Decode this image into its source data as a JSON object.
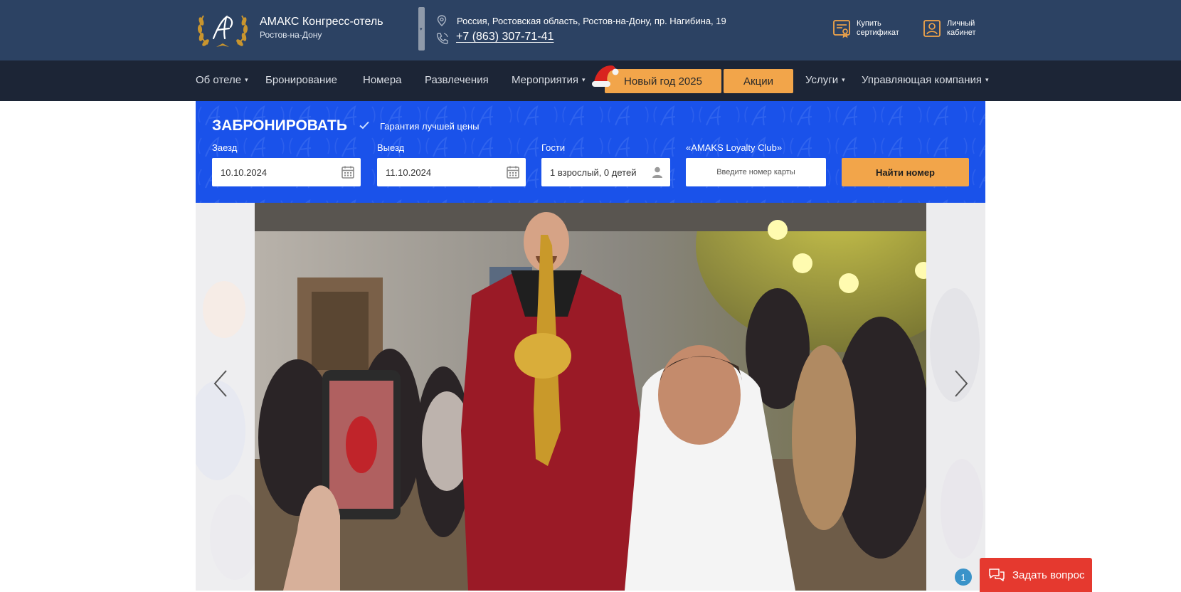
{
  "header": {
    "hotel_name": "АМАКС Конгресс-отель",
    "hotel_city": "Ростов-на-Дону",
    "address": "Россия, Ростовская область, Ростов-на-Дону, пр. Нагибина, 19",
    "phone": "+7 (863) 307-71-41",
    "certificate_label": "Купить сертификат",
    "account_label": "Личный кабинет"
  },
  "nav": {
    "items": [
      {
        "label": "Об отеле",
        "dropdown": true
      },
      {
        "label": "Бронирование",
        "dropdown": false
      },
      {
        "label": "Номера",
        "dropdown": false
      },
      {
        "label": "Развлечения",
        "dropdown": false
      },
      {
        "label": "Мероприятия",
        "dropdown": true
      },
      {
        "label": "Услуги",
        "dropdown": true
      },
      {
        "label": "Управляющая компания",
        "dropdown": true
      }
    ],
    "new_year_button": "Новый год 2025",
    "promo_button": "Акции",
    "dropdown_caret": "▾"
  },
  "booking": {
    "title": "ЗАБРОНИРОВАТЬ",
    "guarantee": "Гарантия лучшей цены",
    "checkin_label": "Заезд",
    "checkin_value": "10.10.2024",
    "checkout_label": "Выезд",
    "checkout_value": "11.10.2024",
    "guests_label": "Гости",
    "guests_value": "1 взрослый, 0 детей",
    "loyalty_label": "«AMAKS Loyalty Club»",
    "loyalty_placeholder": "Введите номер карты",
    "find_button": "Найти номер"
  },
  "chat": {
    "badge_count": "1",
    "button_label": "Задать вопрос"
  },
  "colors": {
    "header_bg": "#2c4263",
    "nav_bg": "#1c2536",
    "booking_bg": "#1a52ea",
    "accent_orange": "#f2a54a",
    "gold": "#c9952e",
    "chat_red": "#e5392f",
    "badge_blue": "#3a93c9"
  },
  "icons": {
    "logo": "hotel-monogram-laurel-logo",
    "address": "map-pin-icon",
    "phone": "phone-icon",
    "certificate": "certificate-icon",
    "account": "user-card-icon",
    "calendar": "calendar-icon",
    "guests": "person-icon",
    "check": "check-icon",
    "prev": "chevron-left-icon",
    "next": "chevron-right-icon",
    "chat": "chat-bubbles-icon"
  }
}
